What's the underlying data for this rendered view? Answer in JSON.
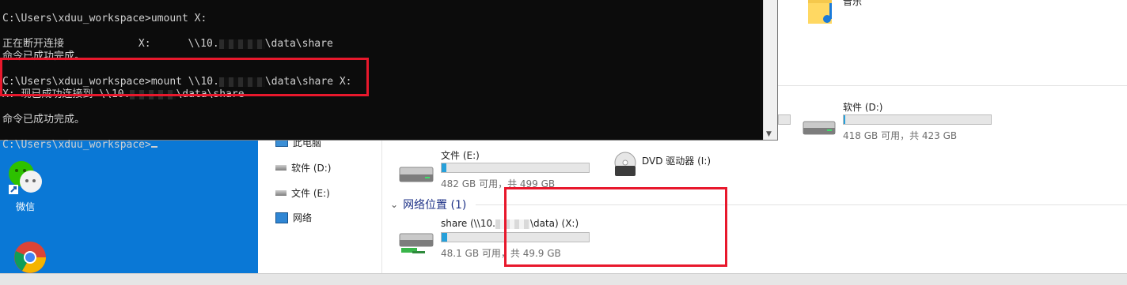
{
  "terminal": {
    "lines": [
      "C:\\Users\\xduu_workspace>umount X:",
      "",
      "正在断开连接            X:      \\\\10.",
      "命令已成功完成。",
      "",
      "C:\\Users\\xduu_workspace>mount \\\\10.",
      "X: 现已成功连接到 \\\\10.",
      "",
      "命令已成功完成。",
      "",
      "C:\\Users\\xduu_workspace>"
    ],
    "line3_tail": "\\data\\share",
    "line6_tail": "\\data\\share X:",
    "line7_tail": "\\data\\share"
  },
  "desktop": {
    "wechat_label": "微信"
  },
  "explorer": {
    "music_label": "音乐",
    "nav": [
      {
        "label": "此电脑",
        "icon": "computer-icon"
      },
      {
        "label": "软件 (D:)",
        "icon": "drive-icon"
      },
      {
        "label": "文件 (E:)",
        "icon": "drive-icon"
      },
      {
        "label": "网络",
        "icon": "network-icon"
      }
    ],
    "drives": [
      {
        "name": "软件 (D:)",
        "info": "418 GB 可用，共 423 GB",
        "used_fraction": 0.012
      },
      {
        "name": "文件 (E:)",
        "info": "482 GB 可用，共 499 GB",
        "used_fraction": 0.034
      },
      {
        "name": "DVD 驱动器 (I:)"
      }
    ],
    "network_section": {
      "title": "网络位置 (1)",
      "share_name_prefix": "share (\\\\10.",
      "share_name_suffix": "\\data) (X:)",
      "share_info": "48.1 GB 可用，共 49.9 GB",
      "used_fraction": 0.036
    }
  },
  "colors": {
    "accent": "#26a0da",
    "highlight": "#e8182c",
    "desktop": "#0a78d6"
  }
}
